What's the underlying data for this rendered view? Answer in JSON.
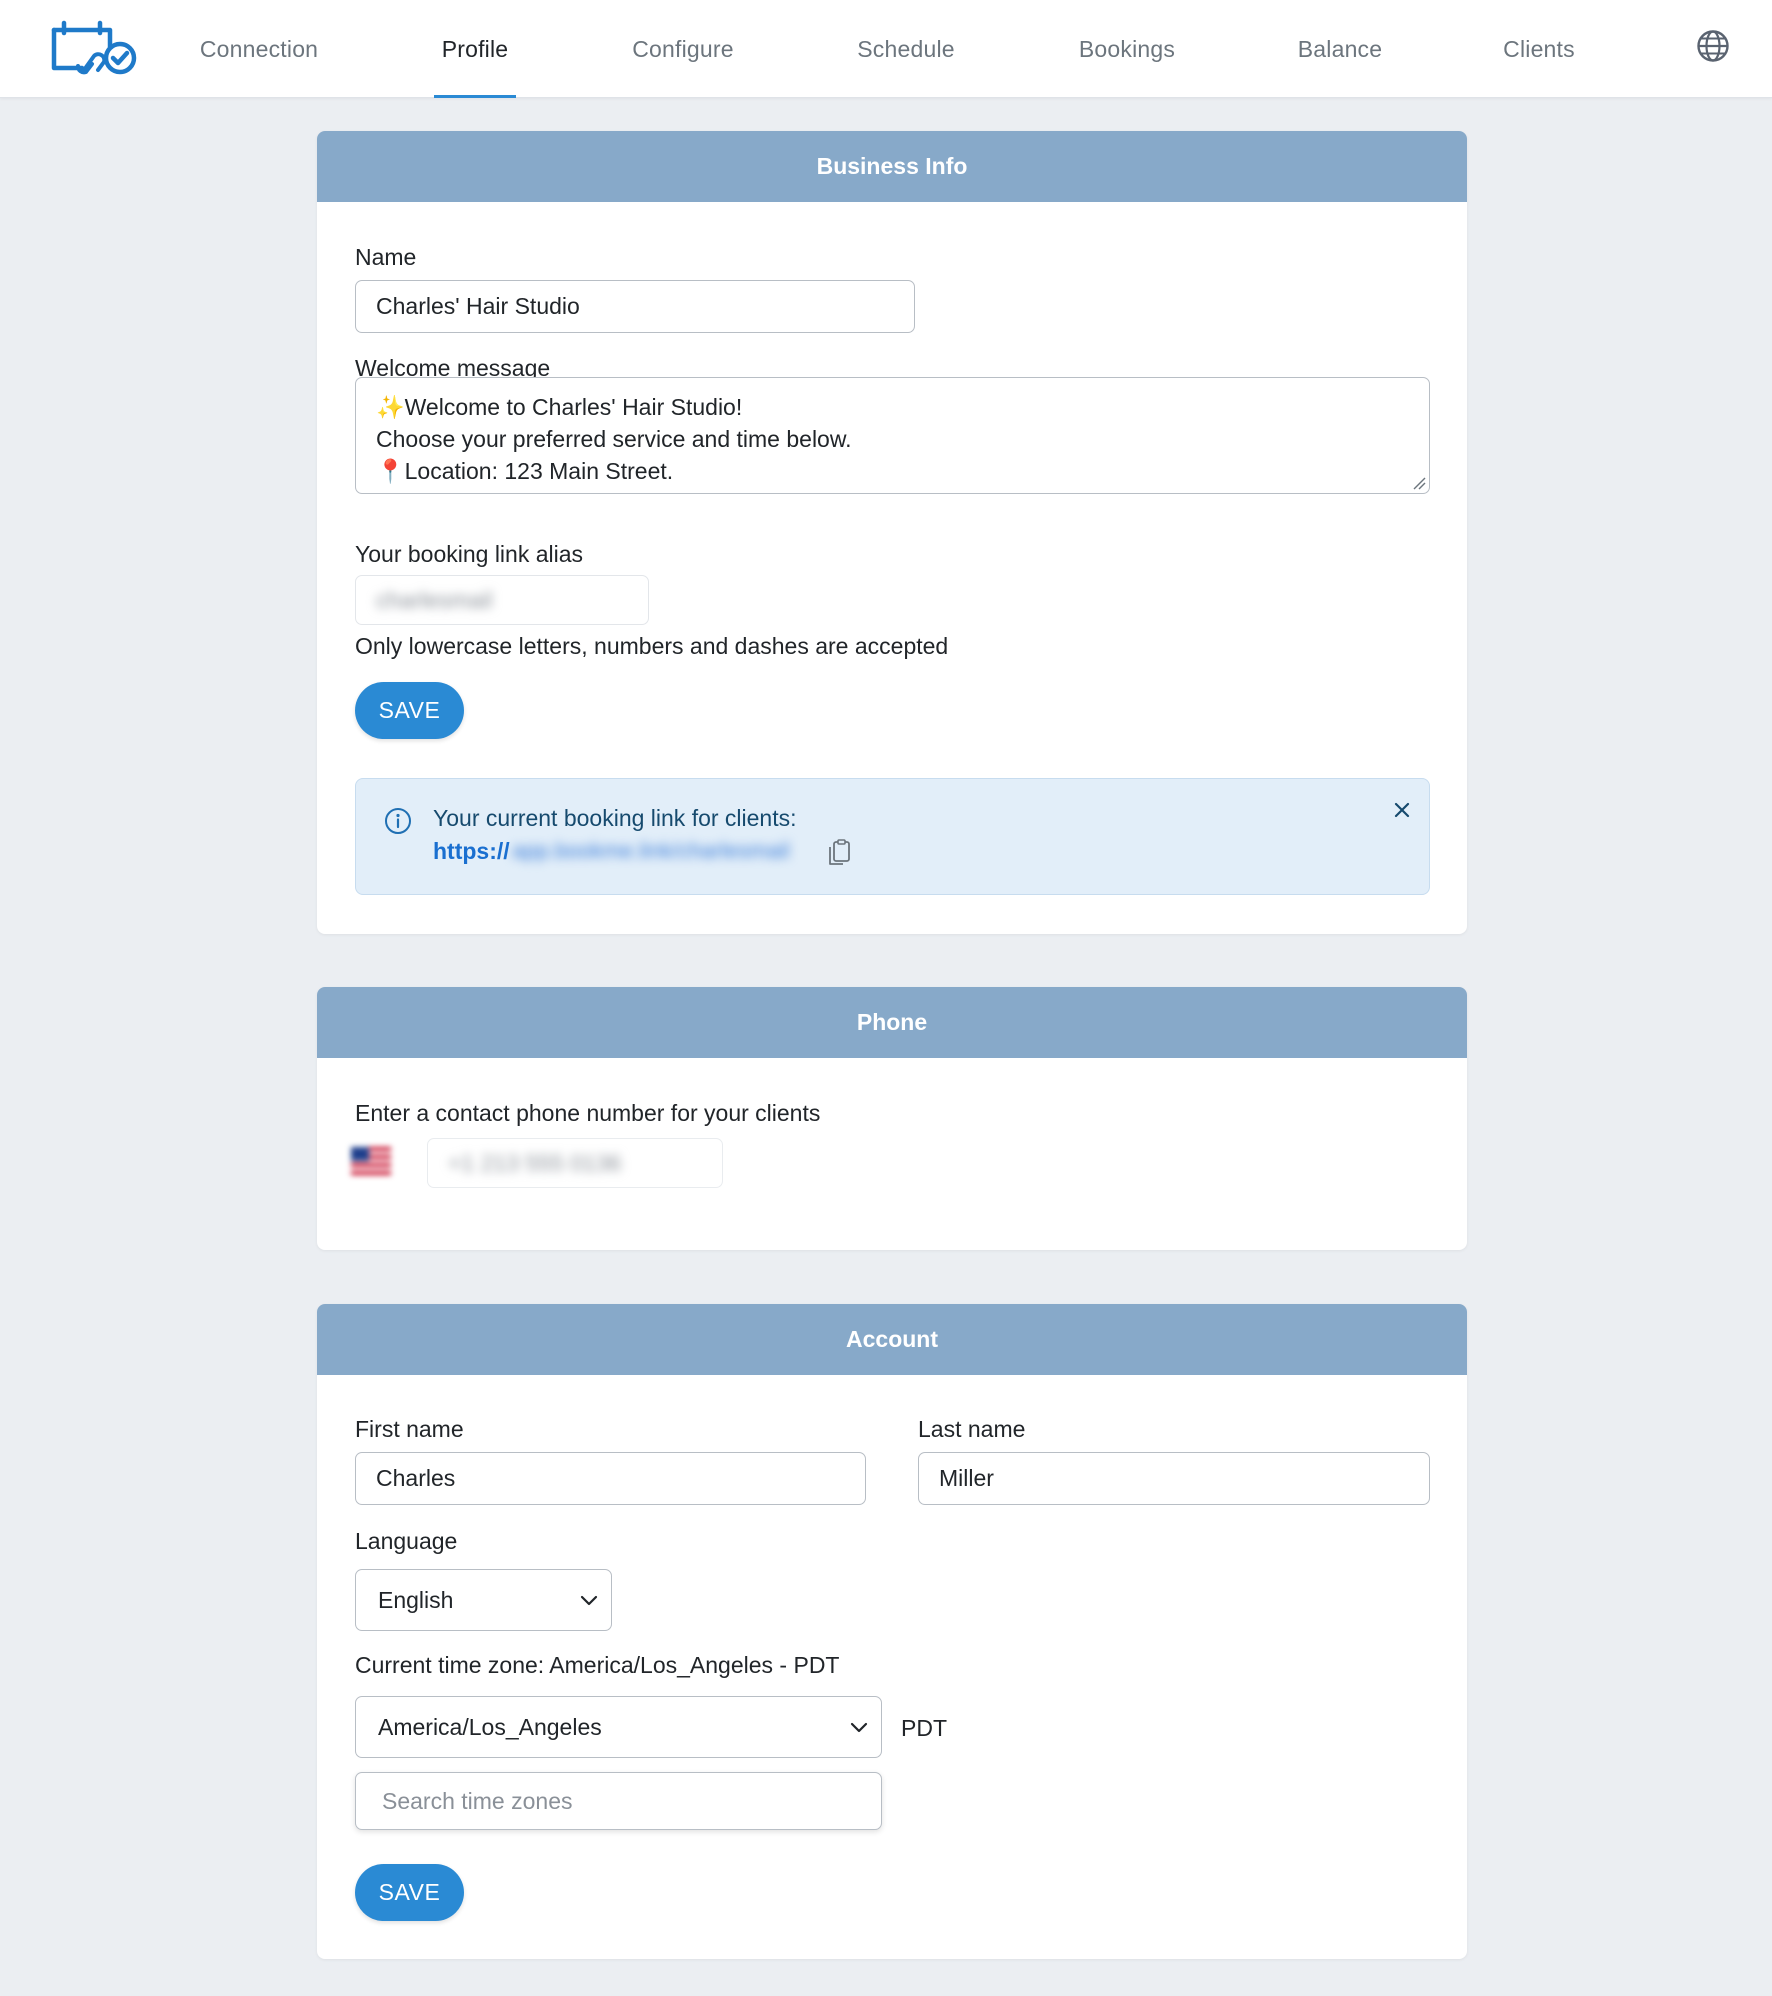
{
  "nav": {
    "items": [
      {
        "label": "Connection"
      },
      {
        "label": "Profile"
      },
      {
        "label": "Configure"
      },
      {
        "label": "Schedule"
      },
      {
        "label": "Bookings"
      },
      {
        "label": "Balance"
      },
      {
        "label": "Clients"
      }
    ],
    "active": "Profile",
    "logo_icon": "calendar-link-check-icon",
    "globe_icon": "globe-icon",
    "accent_color": "#2a8ad4"
  },
  "business_info": {
    "title": "Business Info",
    "name_label": "Name",
    "name_value": "Charles' Hair Studio",
    "welcome_label": "Welcome message",
    "welcome_lines": [
      "✨Welcome to Charles' Hair Studio!",
      "Choose your preferred service and time below.",
      "📍Location: 123 Main Street."
    ],
    "alias_label": "Your booking link alias",
    "alias_value": "charlesmail",
    "alias_hint": "Only lowercase letters, numbers and dashes are accepted",
    "save_label": "SAVE",
    "alert_message": "Your current booking link for clients:",
    "link_prefix": "https://",
    "link_rest": "app.bookme.link/charlesmail"
  },
  "phone": {
    "title": "Phone",
    "prompt": "Enter a contact phone number for your clients",
    "phone_value": "+1 213 555 0136",
    "flag_icon": "us-flag-icon"
  },
  "account": {
    "title": "Account",
    "first_name_label": "First name",
    "first_name_value": "Charles",
    "last_name_label": "Last name",
    "last_name_value": "Miller",
    "language_label": "Language",
    "language_value": "English",
    "timezone_label": "Current time zone: America/Los_Angeles - PDT",
    "timezone_value": "America/Los_Angeles",
    "timezone_abbr": "PDT",
    "search_placeholder": "Search time zones",
    "save_label": "SAVE"
  },
  "colors": {
    "header_bg": "#87a9c9",
    "button": "#2a8ad4",
    "alert_bg": "#e2eef9",
    "page_bg": "#ebeef2"
  }
}
